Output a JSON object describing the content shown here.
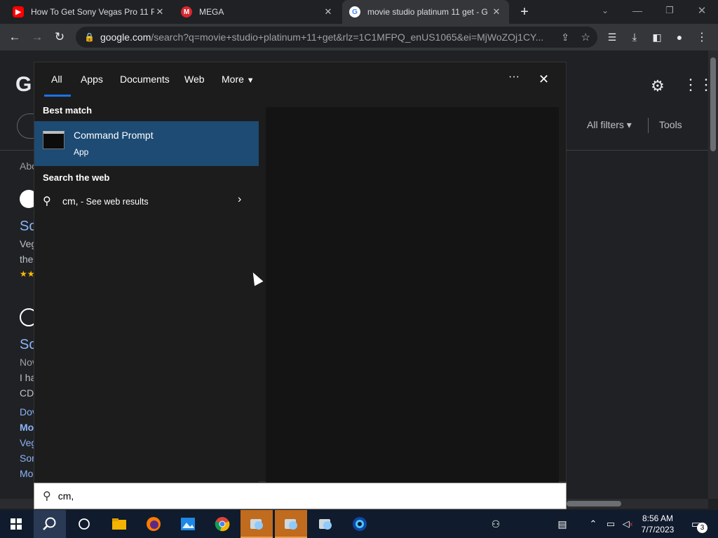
{
  "browser": {
    "tabs": [
      {
        "title": "How To Get Sony Vegas Pro 11 F",
        "favicon": "youtube-icon",
        "active": false
      },
      {
        "title": "MEGA",
        "favicon": "mega-icon",
        "active": false
      },
      {
        "title": "movie studio platinum 11 get - G",
        "favicon": "google-icon",
        "active": true
      }
    ],
    "new_tab": "+",
    "url_host": "google.com",
    "url_rest": "/search?q=movie+studio+platinum+11+get&rlz=1C1MFPQ_enUS1065&ei=MjWoZOj1CY..."
  },
  "page": {
    "logo_letter": "G",
    "filters_label": "All filters",
    "tools_label": "Tools",
    "about_prefix": "Abo",
    "result1_title": "So",
    "result1_line1": "Veg",
    "result1_line2": "the",
    "result2_title": "So",
    "result2_line1": "Nov",
    "result2_line2": "I ha",
    "result2_line3": "CD",
    "sitelinks": [
      "Dov",
      "Mo",
      "Veg",
      "Sor",
      "Mo"
    ]
  },
  "search_flyout": {
    "tabs": [
      "All",
      "Apps",
      "Documents",
      "Web",
      "More"
    ],
    "active_tab": "All",
    "more_options": "···",
    "close": "✕",
    "best_match_heading": "Best match",
    "best_match": {
      "title": "Command Prompt",
      "subtitle": "App"
    },
    "search_web_heading": "Search the web",
    "web_result": {
      "query": "cm,",
      "suffix": " - See web results"
    },
    "query": "cm,"
  },
  "taskbar": {
    "pinned": [
      "start-icon",
      "search-icon",
      "task-view-icon",
      "file-explorer-icon",
      "firefox-icon",
      "photos-icon",
      "chrome-icon",
      "app-icon",
      "app-icon",
      "app-icon",
      "camera-app-icon"
    ],
    "time": "8:56 AM",
    "date": "7/7/2023",
    "notification_count": "3"
  },
  "colors": {
    "accent": "#1a73e8",
    "selected_result": "#1d4b73",
    "taskbar": "#101b2d",
    "active_taskbar_item": "#c06b1e"
  }
}
